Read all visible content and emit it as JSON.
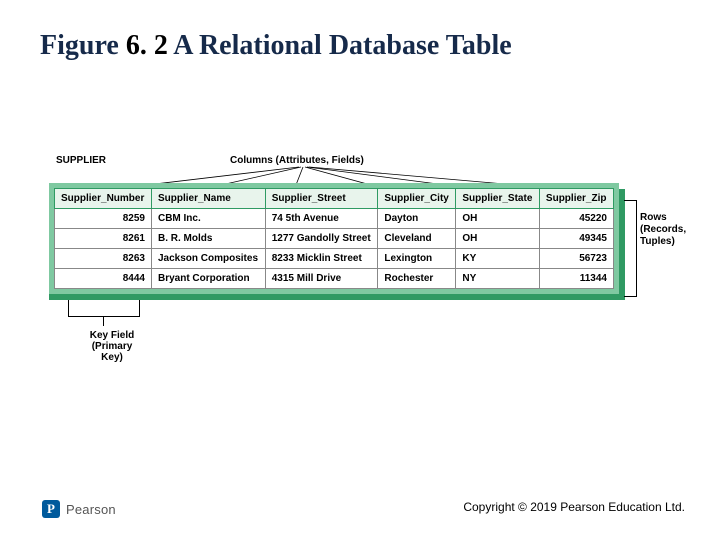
{
  "title_prefix": "Figure ",
  "title_number": "6. 2",
  "title_text": " A Relational Database Table",
  "label_supplier": "SUPPLIER",
  "label_columns": "Columns (Attributes, Fields)",
  "label_rows_l1": "Rows",
  "label_rows_l2": "(Records,",
  "label_rows_l3": "Tuples)",
  "label_key_l1": "Key Field",
  "label_key_l2": "(Primary Key)",
  "brand": "Pearson",
  "brand_letter": "P",
  "copyright": "Copyright © 2019 Pearson Education Ltd.",
  "chart_data": {
    "type": "table",
    "title": "SUPPLIER",
    "columns": [
      "Supplier_Number",
      "Supplier_Name",
      "Supplier_Street",
      "Supplier_City",
      "Supplier_State",
      "Supplier_Zip"
    ],
    "rows": [
      {
        "Supplier_Number": "8259",
        "Supplier_Name": "CBM Inc.",
        "Supplier_Street": "74 5th Avenue",
        "Supplier_City": "Dayton",
        "Supplier_State": "OH",
        "Supplier_Zip": "45220"
      },
      {
        "Supplier_Number": "8261",
        "Supplier_Name": "B. R. Molds",
        "Supplier_Street": "1277 Gandolly Street",
        "Supplier_City": "Cleveland",
        "Supplier_State": "OH",
        "Supplier_Zip": "49345"
      },
      {
        "Supplier_Number": "8263",
        "Supplier_Name": "Jackson Composites",
        "Supplier_Street": "8233 Micklin Street",
        "Supplier_City": "Lexington",
        "Supplier_State": "KY",
        "Supplier_Zip": "56723"
      },
      {
        "Supplier_Number": "8444",
        "Supplier_Name": "Bryant Corporation",
        "Supplier_Street": "4315 Mill Drive",
        "Supplier_City": "Rochester",
        "Supplier_State": "NY",
        "Supplier_Zip": "11344"
      }
    ],
    "primary_key": "Supplier_Number",
    "annotations": {
      "columns_label": "Columns (Attributes, Fields)",
      "rows_label": "Rows (Records, Tuples)",
      "key_label": "Key Field (Primary Key)"
    }
  }
}
